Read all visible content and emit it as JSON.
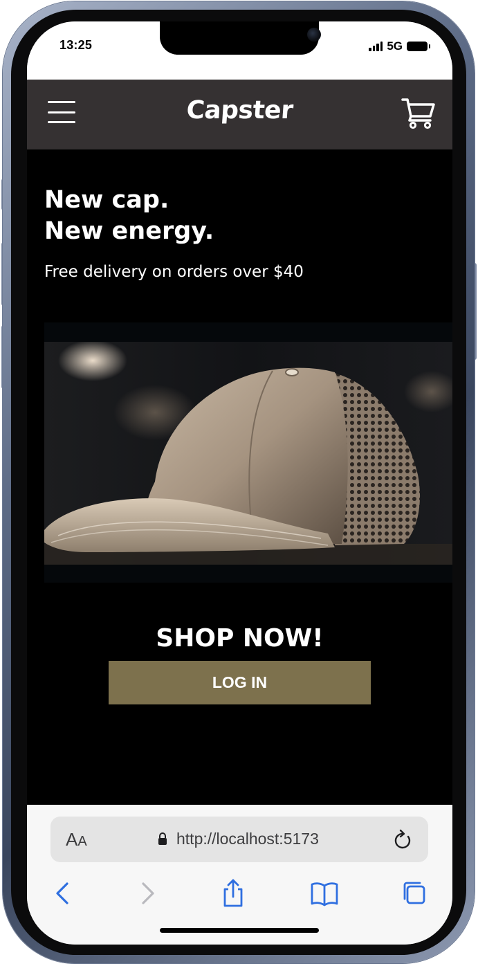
{
  "status_bar": {
    "time": "13:25",
    "network": "5G"
  },
  "header": {
    "brand": "Capster",
    "icons": {
      "menu": "hamburger-menu-icon",
      "cart": "shopping-cart-icon"
    }
  },
  "hero": {
    "title_line1": "New cap.",
    "title_line2": "New energy.",
    "subtitle": "Free delivery on orders over $40",
    "image_alt": "cap-photo"
  },
  "cta": {
    "heading": "SHOP NOW!",
    "login_label": "LOG IN"
  },
  "safari": {
    "text_size_big": "A",
    "text_size_small": "A",
    "url": "http://localhost:5173",
    "icons": {
      "lock": "lock-icon",
      "reload": "reload-icon",
      "back": "back-chevron-icon",
      "forward": "forward-chevron-icon",
      "share": "share-icon",
      "bookmarks": "bookmarks-icon",
      "tabs": "tabs-icon"
    }
  },
  "colors": {
    "header_bg": "#353132",
    "page_bg": "#000000",
    "login_bg": "#7d714d",
    "safari_blue": "#2f6fe0"
  }
}
